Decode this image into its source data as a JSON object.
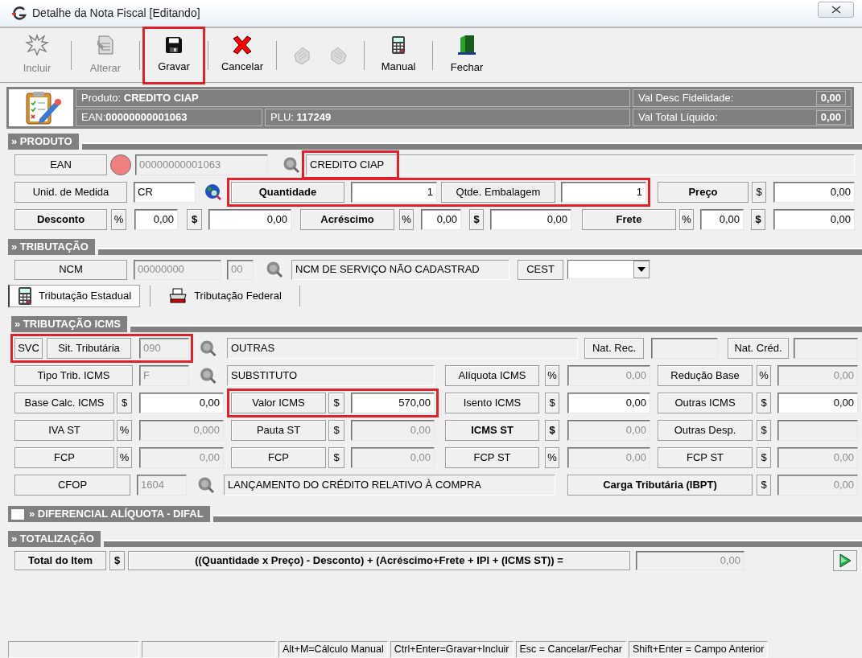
{
  "window": {
    "title": "Detalhe da Nota Fiscal [Editando]"
  },
  "toolbar": [
    {
      "kind": "button",
      "label": "Incluir",
      "disabled": true,
      "highlighted": false
    },
    {
      "kind": "separator"
    },
    {
      "kind": "button",
      "label": "Alterar",
      "disabled": true,
      "highlighted": false
    },
    {
      "kind": "separator"
    },
    {
      "kind": "button",
      "label": "Gravar",
      "disabled": false,
      "highlighted": true
    },
    {
      "kind": "separator"
    },
    {
      "kind": "button",
      "label": "Cancelar",
      "disabled": false,
      "highlighted": false
    },
    {
      "kind": "separator"
    },
    {
      "kind": "icon_button",
      "disabled": true,
      "highlighted": false
    },
    {
      "kind": "icon_button",
      "disabled": true,
      "highlighted": false
    },
    {
      "kind": "separator"
    },
    {
      "kind": "button",
      "label": "Manual",
      "disabled": false,
      "highlighted": false
    },
    {
      "kind": "separator"
    },
    {
      "kind": "button",
      "label": "Fechar",
      "disabled": false,
      "highlighted": false
    }
  ],
  "info": {
    "product": "Produto: **CREDITO CIAP**",
    "ean": "EAN:**00000000001063**",
    "plu": "PLU:  **117249**",
    "fidelity_label": "Val Desc Fidelidade:",
    "fidelity": "0,00",
    "net_label": "Val Total Líquido:",
    "net": "0,00"
  },
  "produto": {
    "title": "» PRODUTO",
    "lines": [
      [
        {
          "kind": "label",
          "text": "EAN"
        },
        {
          "kind": "dot",
          "color": "#f08080"
        },
        {
          "kind": "code",
          "value": "00000000001063",
          "readonly": true
        },
        {
          "kind": "lookup"
        },
        {
          "kind": "text",
          "value": "CREDITO CIAP",
          "highlighted": true
        }
      ],
      [
        {
          "kind": "label",
          "text": "Unid. de Medida"
        },
        {
          "kind": "code",
          "value": "CR",
          "readonly": false
        },
        {
          "kind": "globe"
        },
        {
          "kind": "label",
          "text": "Quantidade",
          "bold": true,
          "highlighted": true
        },
        {
          "kind": "amount",
          "value": "1",
          "readonly": false,
          "highlighted": true
        },
        {
          "kind": "label",
          "text": "Qtde. Embalagem",
          "highlighted": true
        },
        {
          "kind": "amount",
          "value": "1",
          "readonly": false,
          "highlighted": true
        },
        {
          "kind": "label",
          "text": "Preço",
          "bold": true
        },
        {
          "kind": "unit",
          "text": "$"
        },
        {
          "kind": "amount",
          "value": "0,00",
          "readonly": false
        }
      ],
      [
        {
          "kind": "label",
          "text": "Desconto",
          "bold": true
        },
        {
          "kind": "unit",
          "text": "%"
        },
        {
          "kind": "amount",
          "value": "0,00",
          "readonly": false
        },
        {
          "kind": "unit",
          "text": "$",
          "bold": true
        },
        {
          "kind": "amount",
          "value": "0,00",
          "readonly": false
        },
        {
          "kind": "label",
          "text": "Acréscimo",
          "bold": true
        },
        {
          "kind": "unit",
          "text": "%"
        },
        {
          "kind": "amount",
          "value": "0,00",
          "readonly": false
        },
        {
          "kind": "unit",
          "text": "$",
          "bold": true
        },
        {
          "kind": "amount",
          "value": "0,00",
          "readonly": false
        },
        {
          "kind": "label",
          "text": "Frete",
          "bold": true
        },
        {
          "kind": "unit",
          "text": "%"
        },
        {
          "kind": "amount",
          "value": "0,00",
          "readonly": false
        },
        {
          "kind": "unit",
          "text": "$",
          "bold": true
        },
        {
          "kind": "amount",
          "value": "0,00",
          "readonly": false
        }
      ]
    ]
  },
  "tributacao": {
    "title": "» TRIBUTAÇÃO",
    "lines": [
      [
        {
          "kind": "label",
          "text": "NCM"
        },
        {
          "kind": "code",
          "value": "00000000",
          "readonly": true
        },
        {
          "kind": "code",
          "value": "00",
          "readonly": true
        },
        {
          "kind": "lookup"
        },
        {
          "kind": "text",
          "value": "NCM DE SERVIÇO NÃO CADASTRAD"
        },
        {
          "kind": "label",
          "text": "CEST"
        },
        {
          "kind": "select"
        }
      ]
    ],
    "tabs": [
      {
        "label": "Tributação Estadual",
        "selected": true
      },
      {
        "label": "Tributação Federal",
        "selected": false
      }
    ],
    "icms": {
      "title": "» TRIBUTAÇÃO  ICMS",
      "lines": [
        [
          {
            "kind": "label",
            "text": "SVC",
            "highlighted": true
          },
          {
            "kind": "label",
            "text": "Sit. Tributária",
            "highlighted": true
          },
          {
            "kind": "code",
            "value": "090",
            "readonly": true,
            "highlighted": true
          },
          {
            "kind": "lookup"
          },
          {
            "kind": "text",
            "value": "OUTRAS"
          },
          {
            "kind": "label",
            "text": "Nat. Rec."
          },
          {
            "kind": "code",
            "readonly": true
          },
          {
            "kind": "label",
            "text": "Nat. Créd."
          },
          {
            "kind": "code",
            "readonly": true
          }
        ],
        [
          {
            "kind": "label",
            "text": "Tipo Trib. ICMS"
          },
          {
            "kind": "code",
            "value": "F",
            "readonly": true
          },
          {
            "kind": "lookup"
          },
          {
            "kind": "text",
            "value": "SUBSTITUTO"
          },
          {
            "kind": "label",
            "text": "Alíquota ICMS"
          },
          {
            "kind": "unit",
            "text": "%"
          },
          {
            "kind": "amount",
            "value": "0,00",
            "readonly": true
          },
          {
            "kind": "label",
            "text": "Redução Base"
          },
          {
            "kind": "unit",
            "text": "%"
          },
          {
            "kind": "amount",
            "value": "0,00",
            "readonly": true
          }
        ],
        [
          {
            "kind": "label",
            "text": "Base Calc. ICMS"
          },
          {
            "kind": "unit",
            "text": "$"
          },
          {
            "kind": "amount",
            "value": "0,00",
            "readonly": false
          },
          {
            "kind": "label",
            "text": "Valor ICMS",
            "highlighted": true
          },
          {
            "kind": "unit",
            "text": "$",
            "highlighted": true
          },
          {
            "kind": "amount",
            "value": "570,00",
            "readonly": false,
            "highlighted": true
          },
          {
            "kind": "label",
            "text": "Isento ICMS"
          },
          {
            "kind": "unit",
            "text": "$"
          },
          {
            "kind": "amount",
            "value": "0,00",
            "readonly": false
          },
          {
            "kind": "label",
            "text": "Outras ICMS"
          },
          {
            "kind": "unit",
            "text": "$"
          },
          {
            "kind": "amount",
            "value": "0,00",
            "readonly": false
          }
        ],
        [
          {
            "kind": "label",
            "text": "IVA ST"
          },
          {
            "kind": "unit",
            "text": "%"
          },
          {
            "kind": "amount",
            "value": "0,000",
            "readonly": true
          },
          {
            "kind": "label",
            "text": "Pauta ST"
          },
          {
            "kind": "unit",
            "text": "$"
          },
          {
            "kind": "amount",
            "value": "0,00",
            "readonly": true
          },
          {
            "kind": "label",
            "text": "ICMS ST",
            "bold": true
          },
          {
            "kind": "unit",
            "text": "$",
            "bold": true
          },
          {
            "kind": "amount",
            "value": "0,00",
            "readonly": true
          },
          {
            "kind": "label",
            "text": "Outras Desp."
          },
          {
            "kind": "unit",
            "text": "$"
          },
          {
            "kind": "amount",
            "readonly": true
          }
        ],
        [
          {
            "kind": "label",
            "text": "FCP"
          },
          {
            "kind": "unit",
            "text": "%"
          },
          {
            "kind": "amount",
            "value": "0,00",
            "readonly": true
          },
          {
            "kind": "label",
            "text": "FCP"
          },
          {
            "kind": "unit",
            "text": "$"
          },
          {
            "kind": "amount",
            "value": "0,00",
            "readonly": true
          },
          {
            "kind": "label",
            "text": "FCP ST"
          },
          {
            "kind": "unit",
            "text": "%"
          },
          {
            "kind": "amount",
            "value": "0,00",
            "readonly": true
          },
          {
            "kind": "label",
            "text": "FCP ST"
          },
          {
            "kind": "unit",
            "text": "$"
          },
          {
            "kind": "amount",
            "value": "0,00",
            "readonly": true
          }
        ],
        [
          {
            "kind": "label",
            "text": "CFOP"
          },
          {
            "kind": "code",
            "value": "1604",
            "readonly": true
          },
          {
            "kind": "lookup"
          },
          {
            "kind": "text",
            "value": "LANÇAMENTO DO CRÉDITO RELATIVO À COMPRA"
          },
          {
            "kind": "label",
            "text": "Carga Tributária (IBPT)",
            "bold": true
          },
          {
            "kind": "unit",
            "text": "$"
          },
          {
            "kind": "amount",
            "value": "0,00",
            "readonly": true
          }
        ]
      ]
    }
  },
  "difal": {
    "title": "» DIFERENCIAL ALÍQUOTA - DIFAL",
    "checked": false
  },
  "totalizacao": {
    "title": "» TOTALIZAÇÃO",
    "lines": [
      [
        {
          "kind": "label",
          "text": "Total do Item",
          "bold": true
        },
        {
          "kind": "unit",
          "text": "$",
          "bold": true
        },
        {
          "kind": "label",
          "text": "((Quantidade x Preço) - Desconto) + (Acréscimo+Frete + IPI + (ICMS ST)) =",
          "bold": true
        },
        {
          "kind": "amount",
          "value": "0,00",
          "readonly": true
        },
        {
          "kind": "go"
        }
      ]
    ]
  },
  "status_bar": [
    "Alt+M=Cálculo Manual",
    "Ctrl+Enter=Gravar+Incluir",
    "Esc = Cancelar/Fechar",
    "Shift+Enter = Campo Anterior"
  ]
}
